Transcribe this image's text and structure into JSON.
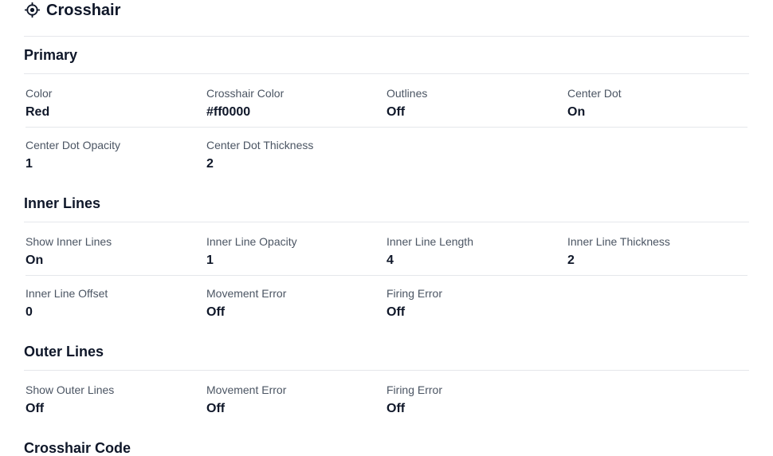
{
  "header": {
    "title": "Crosshair",
    "icon": "crosshair-icon"
  },
  "sections": {
    "primary": {
      "title": "Primary",
      "fields": [
        {
          "label": "Color",
          "value": "Red"
        },
        {
          "label": "Crosshair Color",
          "value": "#ff0000"
        },
        {
          "label": "Outlines",
          "value": "Off"
        },
        {
          "label": "Center Dot",
          "value": "On"
        },
        {
          "label": "Center Dot Opacity",
          "value": "1"
        },
        {
          "label": "Center Dot Thickness",
          "value": "2"
        }
      ]
    },
    "inner_lines": {
      "title": "Inner Lines",
      "fields": [
        {
          "label": "Show Inner Lines",
          "value": "On"
        },
        {
          "label": "Inner Line Opacity",
          "value": "1"
        },
        {
          "label": "Inner Line Length",
          "value": "4"
        },
        {
          "label": "Inner Line Thickness",
          "value": "2"
        },
        {
          "label": "Inner Line Offset",
          "value": "0"
        },
        {
          "label": "Movement Error",
          "value": "Off"
        },
        {
          "label": "Firing Error",
          "value": "Off"
        }
      ]
    },
    "outer_lines": {
      "title": "Outer Lines",
      "fields": [
        {
          "label": "Show Outer Lines",
          "value": "Off"
        },
        {
          "label": "Movement Error",
          "value": "Off"
        },
        {
          "label": "Firing Error",
          "value": "Off"
        }
      ]
    },
    "crosshair_code": {
      "title": "Crosshair Code"
    }
  }
}
